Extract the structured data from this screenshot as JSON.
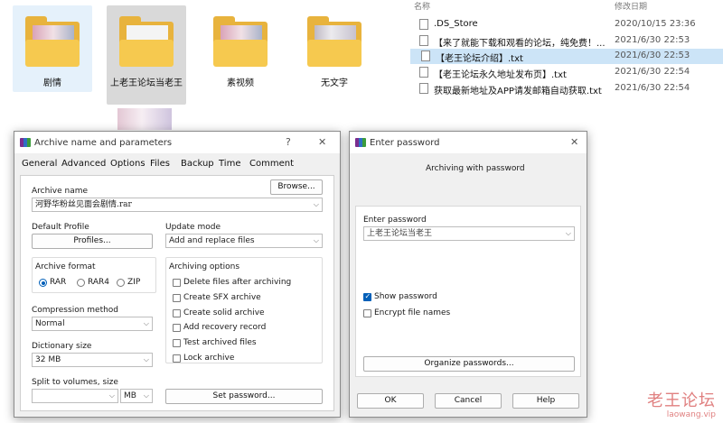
{
  "explorer": {
    "folders": [
      {
        "label": "剧情"
      },
      {
        "label": "上老王论坛当老王"
      },
      {
        "label": "素视频"
      },
      {
        "label": "无文字"
      }
    ]
  },
  "file_list": {
    "header_name": "名称",
    "header_date": "修改日期",
    "files": [
      {
        "name": ".DS_Store",
        "date": "2020/10/15 23:36"
      },
      {
        "name": "【来了就能下载和观看的论坛，纯免费！...",
        "date": "2021/6/30 22:53"
      },
      {
        "name": "【老王论坛介绍】.txt",
        "date": "2021/6/30 22:53"
      },
      {
        "name": "【老王论坛永久地址发布页】.txt",
        "date": "2021/6/30 22:54"
      },
      {
        "name": "获取最新地址及APP请发邮箱自动获取.txt",
        "date": "2021/6/30 22:54"
      }
    ]
  },
  "archive_dialog": {
    "title": "Archive name and parameters",
    "help": "?",
    "close": "✕",
    "tabs": [
      "General",
      "Advanced",
      "Options",
      "Files",
      "Backup",
      "Time",
      "Comment"
    ],
    "archive_name_label": "Archive name",
    "browse": "Browse...",
    "archive_name_value": "河野华粉丝见面会剧情.rar",
    "default_profile_label": "Default Profile",
    "profiles_button": "Profiles...",
    "update_mode_label": "Update mode",
    "update_mode_value": "Add and replace files",
    "archive_format_label": "Archive format",
    "formats": [
      "RAR",
      "RAR4",
      "ZIP"
    ],
    "archiving_options_label": "Archiving options",
    "options": [
      "Delete files after archiving",
      "Create SFX archive",
      "Create solid archive",
      "Add recovery record",
      "Test archived files",
      "Lock archive"
    ],
    "compression_label": "Compression method",
    "compression_value": "Normal",
    "dictionary_label": "Dictionary size",
    "dictionary_value": "32 MB",
    "split_label": "Split to volumes, size",
    "split_unit": "MB",
    "set_password": "Set password..."
  },
  "password_dialog": {
    "title": "Enter password",
    "close": "✕",
    "subtitle": "Archiving with password",
    "enter_label": "Enter password",
    "password_value": "上老王论坛当老王",
    "show_password": "Show password",
    "encrypt_names": "Encrypt file names",
    "organize": "Organize passwords...",
    "ok": "OK",
    "cancel": "Cancel",
    "help": "Help"
  },
  "watermark": {
    "main": "老王论坛",
    "sub": "laowang.vip"
  }
}
